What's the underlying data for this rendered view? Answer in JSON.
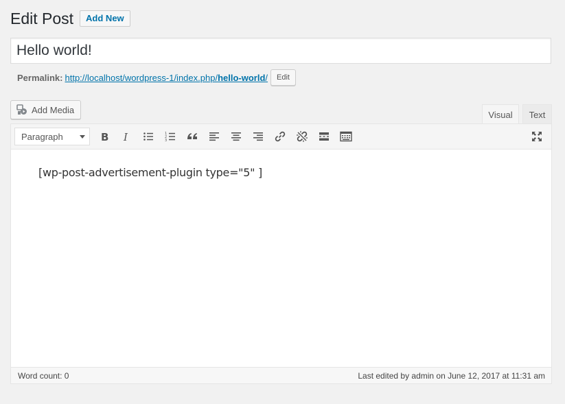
{
  "header": {
    "title": "Edit Post",
    "add_new_label": "Add New"
  },
  "post": {
    "title": "Hello world!",
    "permalink_label": "Permalink:",
    "permalink_base": "http://localhost/wordpress-1/index.php/",
    "permalink_slug": "hello-world",
    "permalink_trailing": "/",
    "edit_slug_label": "Edit"
  },
  "editor": {
    "add_media_label": "Add Media",
    "tabs": [
      {
        "label": "Visual",
        "active": true
      },
      {
        "label": "Text",
        "active": false
      }
    ],
    "format_select": {
      "selected": "Paragraph"
    },
    "toolbar_icons": [
      "bold-icon",
      "italic-icon",
      "bulleted-list-icon",
      "numbered-list-icon",
      "blockquote-icon",
      "align-left-icon",
      "align-center-icon",
      "align-right-icon",
      "insert-link-icon",
      "remove-link-icon",
      "read-more-icon",
      "toolbar-toggle-icon",
      "fullscreen-icon"
    ],
    "content": "[wp-post-advertisement-plugin type=\"5\" ]",
    "word_count": "Word count: 0",
    "last_edited": "Last edited by admin on June 12, 2017 at 11:31 am"
  },
  "colors": {
    "background": "#f1f1f1",
    "link": "#0073aa",
    "text": "#23282d",
    "icon": "#555555"
  }
}
